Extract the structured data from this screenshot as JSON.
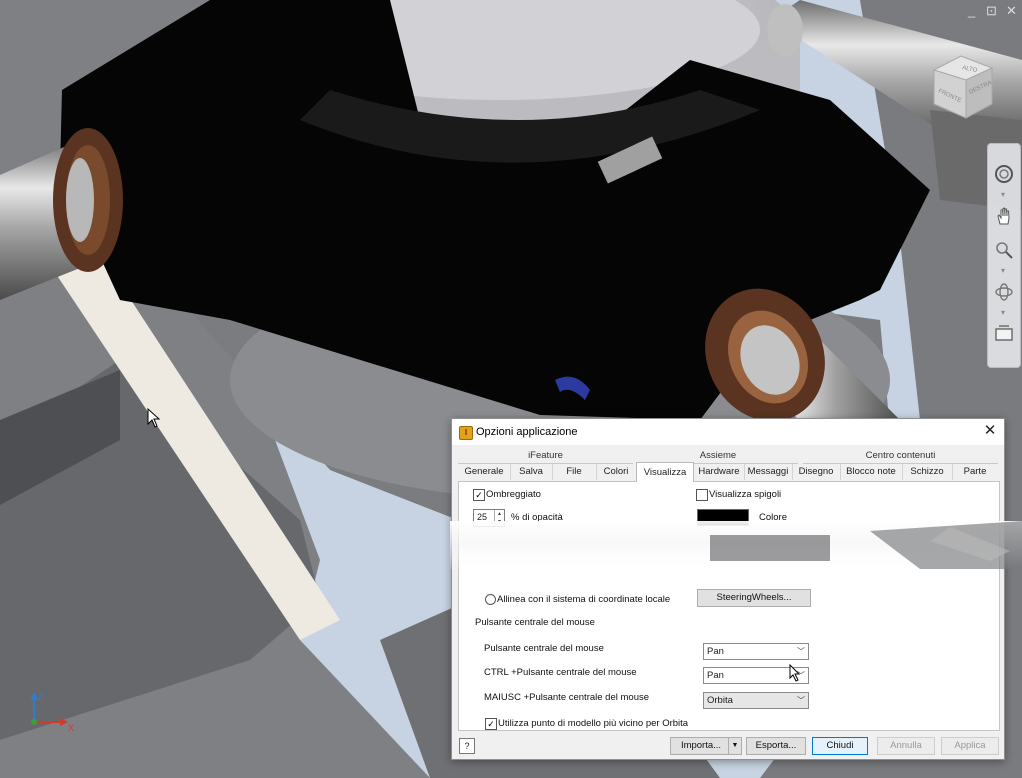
{
  "window_controls": {
    "minimize": "_",
    "restore": "⊡",
    "close": "✕"
  },
  "viewcube": {
    "faces": {
      "top": "ALTO",
      "front": "FRONTE",
      "right": "DESTRA"
    }
  },
  "navbar": {
    "tools": [
      "steeringwheel-icon",
      "pan-icon",
      "zoom-icon",
      "orbit-icon",
      "lookat-icon"
    ]
  },
  "dialog": {
    "icon_text": "I",
    "title": "Opzioni applicazione",
    "close": "✕",
    "tab_groups": {
      "ifeature": "iFeature",
      "assieme": "Assieme",
      "centro": "Centro contenuti"
    },
    "tabs": [
      "Generale",
      "Salva",
      "File",
      "Colori",
      "Visualizza",
      "Hardware",
      "Messaggi",
      "Disegno",
      "Blocco note",
      "Schizzo",
      "Parte"
    ],
    "active_tab": "Visualizza",
    "shaded": {
      "label": "Ombreggiato",
      "checked": true
    },
    "show_edges": {
      "label": "Visualizza spigoli",
      "checked": false
    },
    "opacity": {
      "value": "25",
      "label": "% di opacità"
    },
    "color": {
      "label": "Colore",
      "swatch": "#000000"
    },
    "align_radio": {
      "label": "Allinea con il sistema di coordinate locale",
      "selected": false
    },
    "steering_button": "SteeringWheels...",
    "mouse_section": "Pulsante centrale del mouse",
    "mouse_rows": [
      {
        "label": "Pulsante centrale del mouse",
        "value": "Pan"
      },
      {
        "label": "CTRL +Pulsante centrale del mouse",
        "value": "Pan"
      },
      {
        "label": "MAIUSC +Pulsante centrale del mouse",
        "value": "Orbita"
      }
    ],
    "nearest_point": {
      "label": "Utilizza punto di modello più vicino per Orbita",
      "checked": true
    },
    "help": "?",
    "buttons": {
      "importa": "Importa...",
      "importa_arrow": "▼",
      "esporta": "Esporta...",
      "chiudi": "Chiudi",
      "annulla": "Annulla",
      "applica": "Applica"
    }
  },
  "triad": {
    "z": "Z",
    "x": "X"
  },
  "colors": {
    "accent": "#0078d7",
    "viewport_sky": "#c9d6e6",
    "dialog_bg": "#f0f0f0"
  }
}
